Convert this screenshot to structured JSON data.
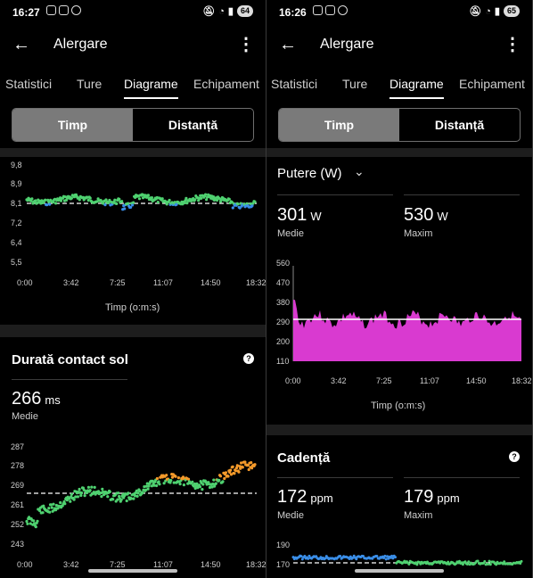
{
  "left": {
    "status": {
      "time": "16:27",
      "battery": "64"
    },
    "appbar": {
      "back_icon": "arrow-left-icon",
      "title": "Alergare",
      "more_icon": "more-vert-icon"
    },
    "tabs": [
      "Statistici",
      "Ture",
      "Diagrame",
      "Echipament"
    ],
    "active_tab": "Diagrame",
    "segment": {
      "time": "Timp",
      "distance": "Distanță",
      "selected": "Timp"
    },
    "chart1": {
      "y_ticks": [
        "9,8",
        "8,9",
        "8,1",
        "7,2",
        "6,4",
        "5,5"
      ],
      "x_ticks": [
        "0:00",
        "3:42",
        "7:25",
        "11:07",
        "14:50",
        "18:32"
      ],
      "xlabel": "Timp (o:m:s)"
    },
    "contact": {
      "title": "Durată contact sol",
      "value": "266",
      "unit": "ms",
      "label": "Medie",
      "y_ticks": [
        "287",
        "278",
        "269",
        "261",
        "252",
        "243"
      ],
      "x_ticks": [
        "0:00",
        "3:42",
        "7:25",
        "11:07",
        "14:50",
        "18:32"
      ]
    }
  },
  "right": {
    "status": {
      "time": "16:26",
      "battery": "65"
    },
    "appbar": {
      "back_icon": "arrow-left-icon",
      "title": "Alergare",
      "more_icon": "more-vert-icon"
    },
    "tabs": [
      "Statistici",
      "Ture",
      "Diagrame",
      "Echipament"
    ],
    "active_tab": "Diagrame",
    "segment": {
      "time": "Timp",
      "distance": "Distanță",
      "selected": "Timp"
    },
    "power": {
      "title": "Putere (W)",
      "avg": "301",
      "avg_unit": "W",
      "avg_label": "Medie",
      "max": "530",
      "max_unit": "W",
      "max_label": "Maxim",
      "y_ticks": [
        "560",
        "470",
        "380",
        "290",
        "200",
        "110"
      ],
      "x_ticks": [
        "0:00",
        "3:42",
        "7:25",
        "11:07",
        "14:50",
        "18:32"
      ],
      "xlabel": "Timp (o:m:s)",
      "fill_color": "#d93ad0"
    },
    "cadence": {
      "title": "Cadență",
      "avg": "172",
      "avg_unit": "ppm",
      "avg_label": "Medie",
      "max": "179",
      "max_unit": "ppm",
      "max_label": "Maxim",
      "y_ticks": [
        "190",
        "170"
      ]
    }
  },
  "colors": {
    "green": "#4fd170",
    "blue": "#3a8ee8",
    "orange": "#f59a2a",
    "pink": "#d93ad0"
  }
}
